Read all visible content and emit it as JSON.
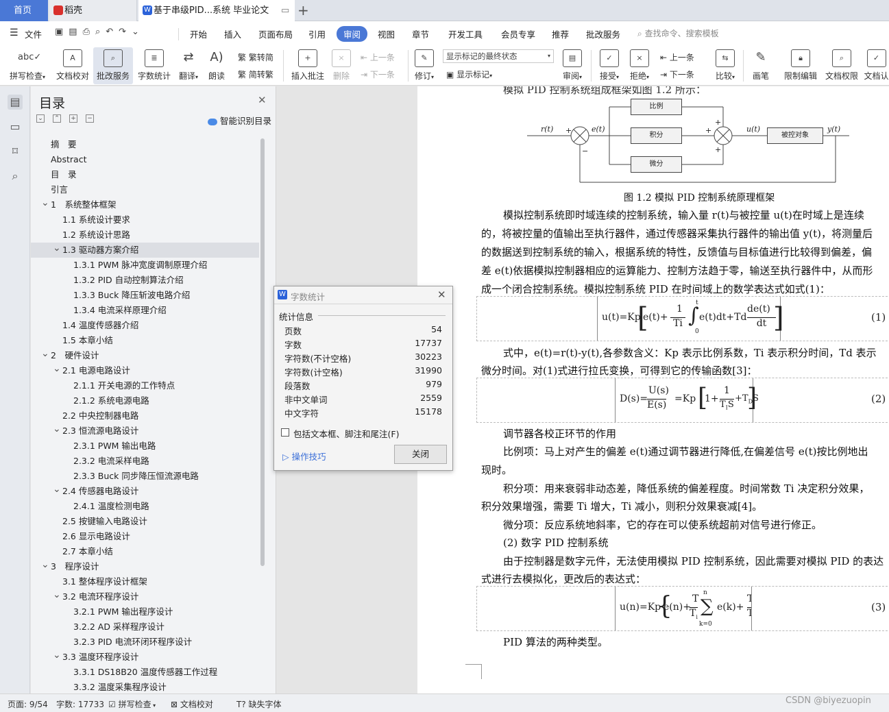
{
  "tabs": {
    "home": "首页",
    "daoke": "稻壳",
    "doc": "基于串级PID...系统 毕业论文"
  },
  "menubar": {
    "file": "文件",
    "items": [
      "开始",
      "插入",
      "页面布局",
      "引用",
      "审阅",
      "视图",
      "章节",
      "开发工具",
      "会员专享",
      "推荐",
      "批改服务"
    ],
    "search_placeholder": "查找命令、搜索模板"
  },
  "ribbon": {
    "spell_check": "拼写检查",
    "doc_proof": "文档校对",
    "correction_service": "批改服务",
    "word_count": "字数统计",
    "translate": "翻译",
    "read_aloud": "朗读",
    "to_traditional": "繁转简",
    "to_simplified": "简转繁",
    "insert_comment": "插入批注",
    "delete": "删除",
    "prev": "上一条",
    "next": "下一条",
    "track_changes": "修订",
    "markup_state": "显示标记的最终状态",
    "show_markup": "显示标记",
    "review": "审阅",
    "accept": "接受",
    "reject": "拒绝",
    "prev2": "上一条",
    "next2": "下一条",
    "compare": "比较",
    "pen": "画笔",
    "restrict_edit": "限制编辑",
    "doc_permission": "文档权限",
    "doc_cert": "文档认"
  },
  "toc": {
    "title": "目录",
    "ai_label": "智能识别目录",
    "items": [
      {
        "label": "摘　要",
        "level": 0
      },
      {
        "label": "Abstract",
        "level": 0
      },
      {
        "label": "目　录",
        "level": 0
      },
      {
        "label": "引言",
        "level": 0
      },
      {
        "label": "1　系统整体框架",
        "level": 1,
        "exp": true
      },
      {
        "label": "1.1  系统设计要求",
        "level": 2
      },
      {
        "label": "1.2  系统设计思路",
        "level": 2
      },
      {
        "label": "1.3  驱动器方案介绍",
        "level": 2,
        "exp": true,
        "sel": true
      },
      {
        "label": "1.3.1 PWM 脉冲宽度调制原理介绍",
        "level": 3
      },
      {
        "label": "1.3.2 PID 自动控制算法介绍",
        "level": 3
      },
      {
        "label": "1.3.3 Buck 降压斩波电路介绍",
        "level": 3
      },
      {
        "label": "1.3.4 电流采样原理介绍",
        "level": 3
      },
      {
        "label": "1.4  温度传感器介绍",
        "level": 2
      },
      {
        "label": "1.5  本章小结",
        "level": 2
      },
      {
        "label": "2　硬件设计",
        "level": 1,
        "exp": true
      },
      {
        "label": "2.1  电源电路设计",
        "level": 2,
        "exp": true
      },
      {
        "label": "2.1.1 开关电源的工作特点",
        "level": 3
      },
      {
        "label": "2.1.2 系统电源电路",
        "level": 3
      },
      {
        "label": "2.2  中央控制器电路",
        "level": 2
      },
      {
        "label": "2.3  恒流源电路设计",
        "level": 2,
        "exp": true
      },
      {
        "label": "2.3.1 PWM 输出电路",
        "level": 3
      },
      {
        "label": "2.3.2 电流采样电路",
        "level": 3
      },
      {
        "label": "2.3.3 Buck 同步降压恒流源电路",
        "level": 3
      },
      {
        "label": "2.4  传感器电路设计",
        "level": 2,
        "exp": true
      },
      {
        "label": "2.4.1 温度检测电路",
        "level": 3
      },
      {
        "label": "2.5  按键输入电路设计",
        "level": 2
      },
      {
        "label": "2.6  显示电路设计",
        "level": 2
      },
      {
        "label": "2.7  本章小结",
        "level": 2
      },
      {
        "label": "3　程序设计",
        "level": 1,
        "exp": true
      },
      {
        "label": "3.1  整体程序设计框架",
        "level": 2
      },
      {
        "label": "3.2  电流环程序设计",
        "level": 2,
        "exp": true
      },
      {
        "label": "3.2.1 PWM 输出程序设计",
        "level": 3
      },
      {
        "label": "3.2.2 AD 采样程序设计",
        "level": 3
      },
      {
        "label": "3.2.3 PID 电流环闭环程序设计",
        "level": 3
      },
      {
        "label": "3.3  温度环程序设计",
        "level": 2,
        "exp": true
      },
      {
        "label": "3.3.1 DS18B20 温度传感器工作过程",
        "level": 3
      },
      {
        "label": "3.3.2 温度采集程序设计",
        "level": 3
      }
    ]
  },
  "dialog": {
    "title": "字数统计",
    "section": "统计信息",
    "stats": [
      {
        "label": "页数",
        "value": "54"
      },
      {
        "label": "字数",
        "value": "17737"
      },
      {
        "label": "字符数(不计空格)",
        "value": "30223"
      },
      {
        "label": "字符数(计空格)",
        "value": "31990"
      },
      {
        "label": "段落数",
        "value": "979"
      },
      {
        "label": "非中文单词",
        "value": "2559"
      },
      {
        "label": "中文字符",
        "value": "15178"
      }
    ],
    "checkbox_label": "包括文本框、脚注和尾注(F)",
    "tips": "操作技巧",
    "close": "关闭"
  },
  "document": {
    "top_cut": "模拟 PID 控制系统组成框架如图 1.2 所示：",
    "diagram": {
      "p": "比例",
      "i": "积分",
      "d": "微分",
      "plant": "被控对象",
      "rt": "r(t)",
      "et": "e(t)",
      "ut": "u(t)",
      "yt": "y(t)",
      "plus": "+",
      "minus": "−"
    },
    "caption": "图 1.2 模拟 PID 控制系统原理框架",
    "paragraphs": [
      "模拟控制系统即时域连续的控制系统，输入量 r(t)与被控量 u(t)在时域上是连续",
      "的，将被控量的值输出至执行器件，通过传感器采集执行器件的输出值 y(t)，将测量后",
      "的数据送到控制系统的输入，根据系统的特性，反馈值与目标值进行比较得到偏差，偏",
      "差 e(t)依据模拟控制器相应的运算能力、控制方法趋于零，输送至执行器件中，从而形",
      "成一个闭合控制系统。模拟控制系统 PID 在时间域上的数学表达式如式(1)："
    ],
    "eq1": {
      "lhs": "u(t)=Kp",
      "a": "e(t)+",
      "b": "1",
      "c": "Ti",
      "d": "e(t)dt+Td",
      "e": "de(t)",
      "f": "dt",
      "up": "t",
      "lo": "0",
      "num": "(1)"
    },
    "p2a": "式中，e(t)=r(t)-y(t),各参数含义：Kp 表示比例系数，Ti 表示积分时间，Td 表示",
    "p2b": "微分时间。对(1)式进行拉氏变换，可得到它的传输函数[3]：",
    "eq2": {
      "lhs": "D(s)=",
      "n": "U(s)",
      "d": "E(s)",
      "m": "=Kp",
      "r": "1+",
      "o": "1",
      "ts": "T",
      "sub": "I",
      "s": "S",
      "t": "+T",
      "dsub": "D",
      "s2": "S",
      "num": "(2)"
    },
    "p3": "调节器各校正环节的作用",
    "p4a": "比例项：马上对产生的偏差 e(t)通过调节器进行降低,在偏差信号 e(t)按比例地出",
    "p4b": "现时。",
    "p5a": "积分项：用来衰弱非动态差，降低系统的偏差程度。时间常数 Ti 决定积分效果，",
    "p5b": "积分效果增强，需要 Ti 增大，Ti 减小，则积分效果衰减[4]。",
    "p6": "微分项：反应系统地斜率，它的存在可以使系统超前对信号进行修正。",
    "p7": "(2) 数字 PID 控制系统",
    "p8a": "由于控制器是数字元件，无法使用模拟 PID 控制系统，因此需要对模拟 PID 的表达",
    "p8b": "式进行去模拟化，更改后的表达式：",
    "eq3": {
      "lhs": "u(n)=Kp",
      "a": "e(n)+",
      "b": "T",
      "c": "T",
      "sub": "i",
      "sum_up": "n",
      "sum_lo": "k=0",
      "sig": "∑",
      "e": "e(k)+",
      "f": "T",
      "g": "T",
      "num": "(3)"
    },
    "p9": "PID 算法的两种类型。"
  },
  "statusbar": {
    "page": "页面: 9/54",
    "words": "字数: 17733",
    "spell": "拼写检查",
    "proof": "文档校对",
    "font": "缺失字体"
  },
  "watermark": "CSDN @biyezuopin",
  "colors": {
    "accent": "#4a78d6",
    "tab_active_bg": "#ffffff",
    "ribbon_active": "#dfe4ee"
  }
}
